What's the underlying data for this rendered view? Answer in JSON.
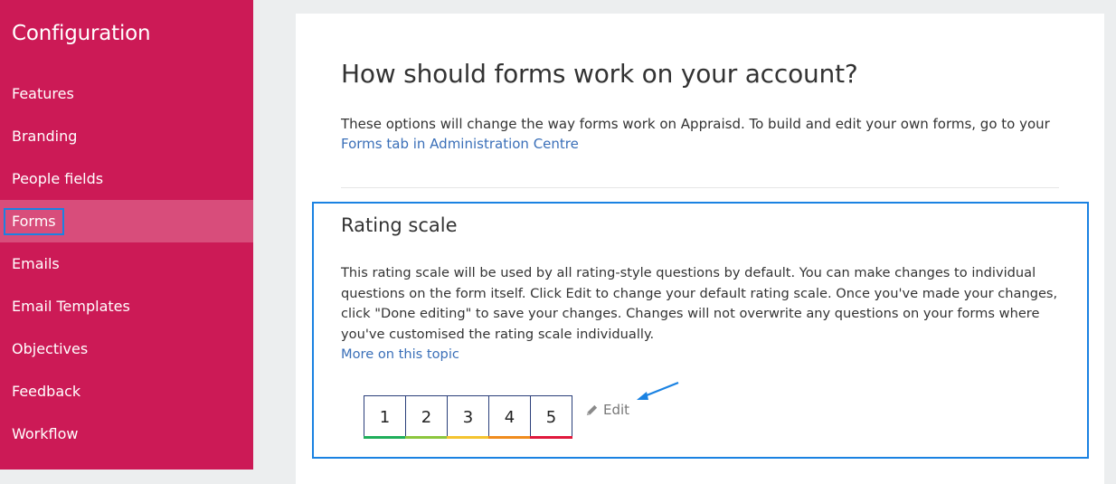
{
  "sidebar": {
    "title": "Configuration",
    "items": [
      {
        "label": "Features",
        "active": false
      },
      {
        "label": "Branding",
        "active": false
      },
      {
        "label": "People fields",
        "active": false
      },
      {
        "label": "Forms",
        "active": true
      },
      {
        "label": "Emails",
        "active": false
      },
      {
        "label": "Email Templates",
        "active": false
      },
      {
        "label": "Objectives",
        "active": false
      },
      {
        "label": "Feedback",
        "active": false
      },
      {
        "label": "Workflow",
        "active": false
      }
    ]
  },
  "main": {
    "title": "How should forms work on your account?",
    "intro_text": "These options will change the way forms work on Appraisd. To build and edit your own forms, go to your",
    "intro_link": "Forms tab in Administration Centre",
    "rating": {
      "title": "Rating scale",
      "description": "This rating scale will be used by all rating-style questions by default. You can make changes to individual questions on the form itself. Click Edit to change your default rating scale. Once you've made your changes, click \"Done editing\" to save your changes. Changes will not overwrite any questions on your forms where you've customised the rating scale individually.",
      "more_link": "More on this topic",
      "scale": [
        {
          "value": "1",
          "color": "#1fae5b"
        },
        {
          "value": "2",
          "color": "#8cc63e"
        },
        {
          "value": "3",
          "color": "#f4c430"
        },
        {
          "value": "4",
          "color": "#f08c1e"
        },
        {
          "value": "5",
          "color": "#e0183c"
        }
      ],
      "edit_label": "Edit"
    }
  },
  "colors": {
    "sidebar_bg": "#cc1a56",
    "active_item_bg": "#d84d7b",
    "highlight": "#1a82e2",
    "link": "#3a6fb8"
  }
}
